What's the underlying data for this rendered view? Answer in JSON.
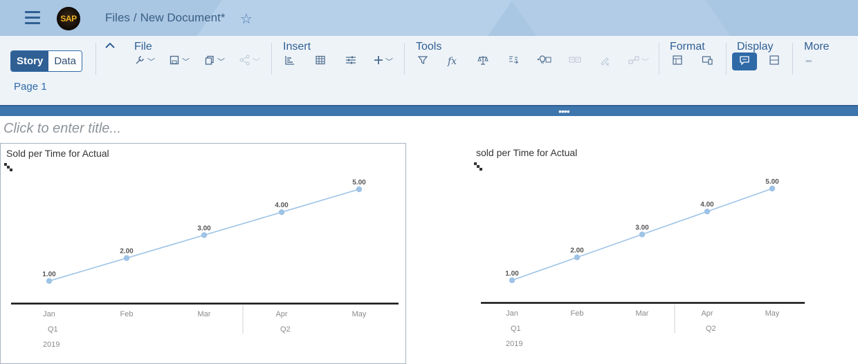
{
  "shell": {
    "breadcrumb_root": "Files",
    "breadcrumb_sep": "/",
    "document_title": "New Document*",
    "logo_text": "SAP",
    "icons": [
      "hamburger-menu-icon",
      "star-icon"
    ]
  },
  "toolbar": {
    "segment": {
      "story": "Story",
      "data": "Data",
      "selected": "Story"
    },
    "collapse": "^",
    "groups": {
      "file": "File",
      "insert": "Insert",
      "tools": "Tools",
      "format": "Format",
      "display": "Display",
      "more": "More"
    },
    "more_glyph": "◦◦◦",
    "active_tool": "comment"
  },
  "page_tab": "Page 1",
  "canvas": {
    "resizer_glyph": "••••",
    "title_placeholder": "Click to enter title..."
  },
  "colors": {
    "shell": "#a9c6e3",
    "toolbar": "#eef3f8",
    "accent": "#2f5f93",
    "series": "#9ec3e6",
    "resizer": "#3d76ad"
  },
  "chart_data": [
    {
      "type": "line",
      "title": "Sold per Time for Actual",
      "categories": [
        "Jan",
        "Feb",
        "Mar",
        "Apr",
        "May"
      ],
      "quarters": [
        {
          "label": "Q1",
          "months": 3
        },
        {
          "label": "Q2",
          "months": 2
        }
      ],
      "year": "2019",
      "values": [
        1.0,
        2.0,
        3.0,
        4.0,
        5.0
      ],
      "value_labels": [
        "1.00",
        "2.00",
        "3.00",
        "4.00",
        "5.00"
      ],
      "grid": false,
      "legend": "none"
    },
    {
      "type": "line",
      "title": "sold per Time for Actual",
      "categories": [
        "Jan",
        "Feb",
        "Mar",
        "Apr",
        "May"
      ],
      "quarters": [
        {
          "label": "Q1",
          "months": 3
        },
        {
          "label": "Q2",
          "months": 2
        }
      ],
      "year": "2019",
      "values": [
        1.0,
        2.0,
        3.0,
        4.0,
        5.0
      ],
      "value_labels": [
        "1.00",
        "2.00",
        "3.00",
        "4.00",
        "5.00"
      ],
      "grid": false,
      "legend": "none"
    }
  ]
}
